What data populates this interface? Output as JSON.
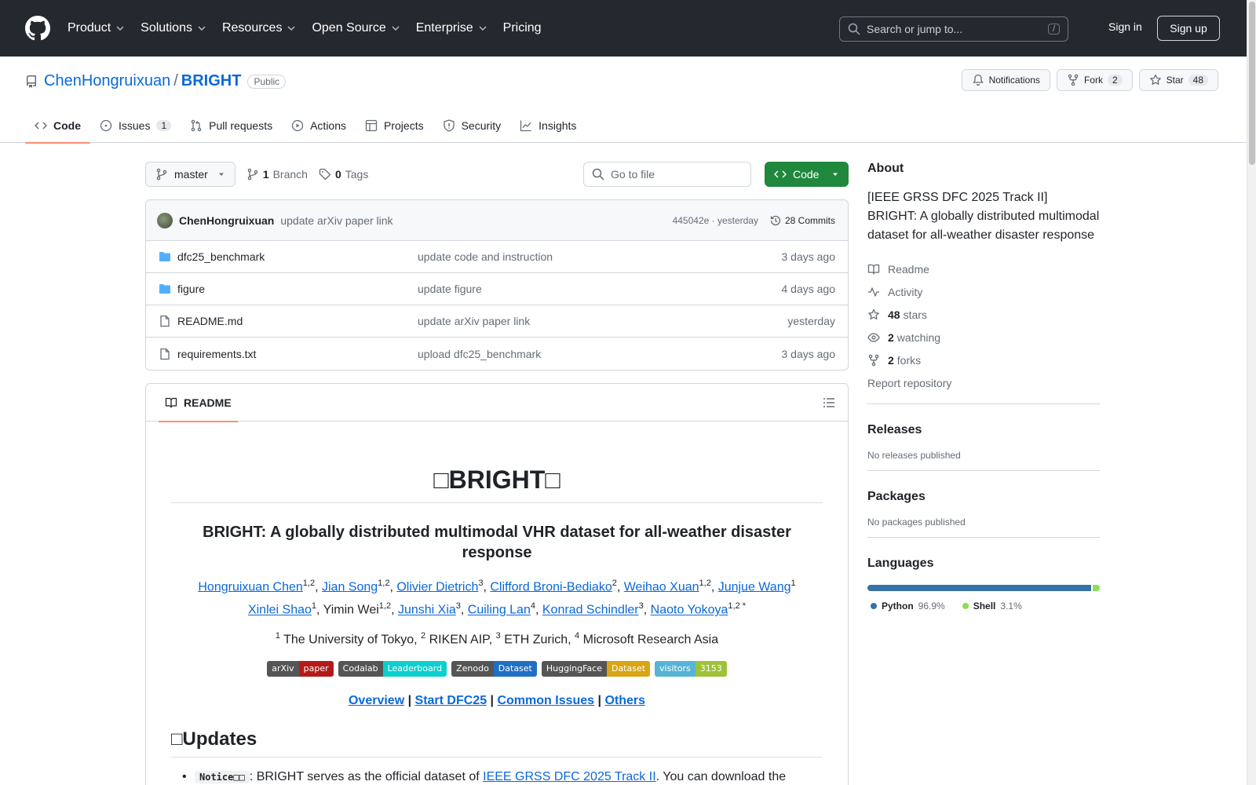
{
  "header": {
    "nav": [
      "Product",
      "Solutions",
      "Resources",
      "Open Source",
      "Enterprise",
      "Pricing"
    ],
    "search_placeholder": "Search or jump to...",
    "search_shortcut": "/",
    "signin": "Sign in",
    "signup": "Sign up"
  },
  "repo": {
    "owner": "ChenHongruixuan",
    "separator": "/",
    "name": "BRIGHT",
    "visibility": "Public",
    "notifications_label": "Notifications",
    "fork_label": "Fork",
    "fork_count": "2",
    "star_label": "Star",
    "star_count": "48",
    "tabs": [
      {
        "label": "Code",
        "count": ""
      },
      {
        "label": "Issues",
        "count": "1"
      },
      {
        "label": "Pull requests",
        "count": ""
      },
      {
        "label": "Actions",
        "count": ""
      },
      {
        "label": "Projects",
        "count": ""
      },
      {
        "label": "Security",
        "count": ""
      },
      {
        "label": "Insights",
        "count": ""
      }
    ]
  },
  "toolbar": {
    "branch": "master",
    "branch_count": "1",
    "branch_label": "Branch",
    "tag_count": "0",
    "tag_label": "Tags",
    "goto_placeholder": "Go to file",
    "code_label": "Code"
  },
  "commit": {
    "author": "ChenHongruixuan",
    "message": "update arXiv paper link",
    "hash_time": "445042e · yesterday",
    "commits": "28 Commits"
  },
  "files": [
    {
      "type": "folder",
      "name": "dfc25_benchmark",
      "message": "update code and instruction",
      "date": "3 days ago"
    },
    {
      "type": "folder",
      "name": "figure",
      "message": "update figure",
      "date": "4 days ago"
    },
    {
      "type": "file",
      "name": "README.md",
      "message": "update arXiv paper link",
      "date": "yesterday"
    },
    {
      "type": "file",
      "name": "requirements.txt",
      "message": "upload dfc25_benchmark",
      "date": "3 days ago"
    }
  ],
  "readme": {
    "tab_label": "README",
    "h1": "□BRIGHT□",
    "h3": "BRIGHT: A globally distributed multimodal VHR dataset for all-weather disaster response",
    "authors_line1": [
      {
        "name": "Hongruixuan Chen",
        "sup": "1,2"
      },
      {
        "name": "Jian Song",
        "sup": "1,2"
      },
      {
        "name": "Olivier Dietrich",
        "sup": "3"
      },
      {
        "name": "Clifford Broni-Bediako",
        "sup": "2"
      },
      {
        "name": "Weihao Xuan",
        "sup": "1,2"
      },
      {
        "name": "Junjue Wang",
        "sup": "1"
      }
    ],
    "authors_line2": [
      {
        "name": "Xinlei Shao",
        "sup": "1",
        "link": true
      },
      {
        "name": "Yimin Wei",
        "sup": "1,2",
        "link": false
      },
      {
        "name": "Junshi Xia",
        "sup": "3",
        "link": true
      },
      {
        "name": "Cuiling Lan",
        "sup": "4",
        "link": true
      },
      {
        "name": "Konrad Schindler",
        "sup": "3",
        "link": true
      },
      {
        "name": "Naoto Yokoya",
        "sup": "1,2 *",
        "link": true
      }
    ],
    "affiliations": [
      {
        "sup": "1",
        "name": "The University of Tokyo"
      },
      {
        "sup": "2",
        "name": "RIKEN AIP"
      },
      {
        "sup": "3",
        "name": "ETH Zurich"
      },
      {
        "sup": "4",
        "name": "Microsoft Research Asia"
      }
    ],
    "shields": [
      {
        "left": "arXiv",
        "right": "paper",
        "right_color": "#b31b1b"
      },
      {
        "left": "Codalab",
        "right": "Leaderboard",
        "right_color": "#0dcfcf"
      },
      {
        "left": "Zenodo",
        "right": "Dataset",
        "right_color": "#1f6fc5"
      },
      {
        "left": "HuggingFace",
        "right": "Dataset",
        "right_color": "#d9a514"
      },
      {
        "left": "visitors",
        "right": "3153",
        "right_color": "#9ec23a",
        "left_color": "#56b5d6"
      }
    ],
    "links": [
      "Overview",
      "Start DFC25",
      "Common Issues",
      "Others"
    ],
    "updates_heading": "□Updates",
    "notice_code": "Notice□□",
    "notice_text": ": BRIGHT serves as the official dataset of ",
    "notice_link": "IEEE GRSS DFC 2025 Track II",
    "notice_tail": ". You can download the"
  },
  "about": {
    "heading": "About",
    "description": "[IEEE GRSS DFC 2025 Track II] BRIGHT: A globally distributed multimodal dataset for all-weather disaster response",
    "readme": "Readme",
    "activity": "Activity",
    "stars_count": "48",
    "stars_label": "stars",
    "watching_count": "2",
    "watching_label": "watching",
    "forks_count": "2",
    "forks_label": "forks",
    "report": "Report repository"
  },
  "releases": {
    "heading": "Releases",
    "text": "No releases published"
  },
  "packages": {
    "heading": "Packages",
    "text": "No packages published"
  },
  "languages": {
    "heading": "Languages",
    "items": [
      {
        "name": "Python",
        "pct": "96.9%",
        "value": 96.9,
        "color": "#3572A5"
      },
      {
        "name": "Shell",
        "pct": "3.1%",
        "value": 3.1,
        "color": "#89e051"
      }
    ]
  }
}
